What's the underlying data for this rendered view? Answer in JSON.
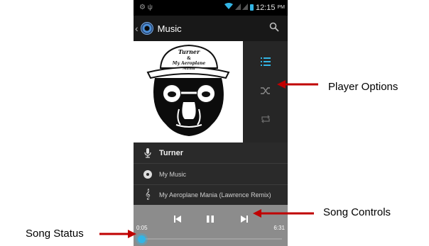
{
  "status_bar": {
    "time": "12:15",
    "ampm": "PM"
  },
  "action_bar": {
    "title": "Music"
  },
  "album_art": {
    "line1": "Turner",
    "line2": "&",
    "line3": "My Aeroplane",
    "line4": "Mania"
  },
  "player_options": [
    "playlist-icon",
    "shuffle-icon",
    "repeat-icon"
  ],
  "track_info": {
    "artist": "Turner",
    "album": "My Music",
    "song": "My Aeroplane Mania (Lawrence Remix)"
  },
  "controls": {
    "elapsed": "0:05",
    "duration": "6:31",
    "progress": 0.013
  },
  "callouts": {
    "player_options": "Player Options",
    "song_controls": "Song Controls",
    "song_status": "Song Status"
  },
  "colors": {
    "accent": "#33b5e5",
    "arrow": "#c00000",
    "control_bar": "#8c8c8c"
  }
}
